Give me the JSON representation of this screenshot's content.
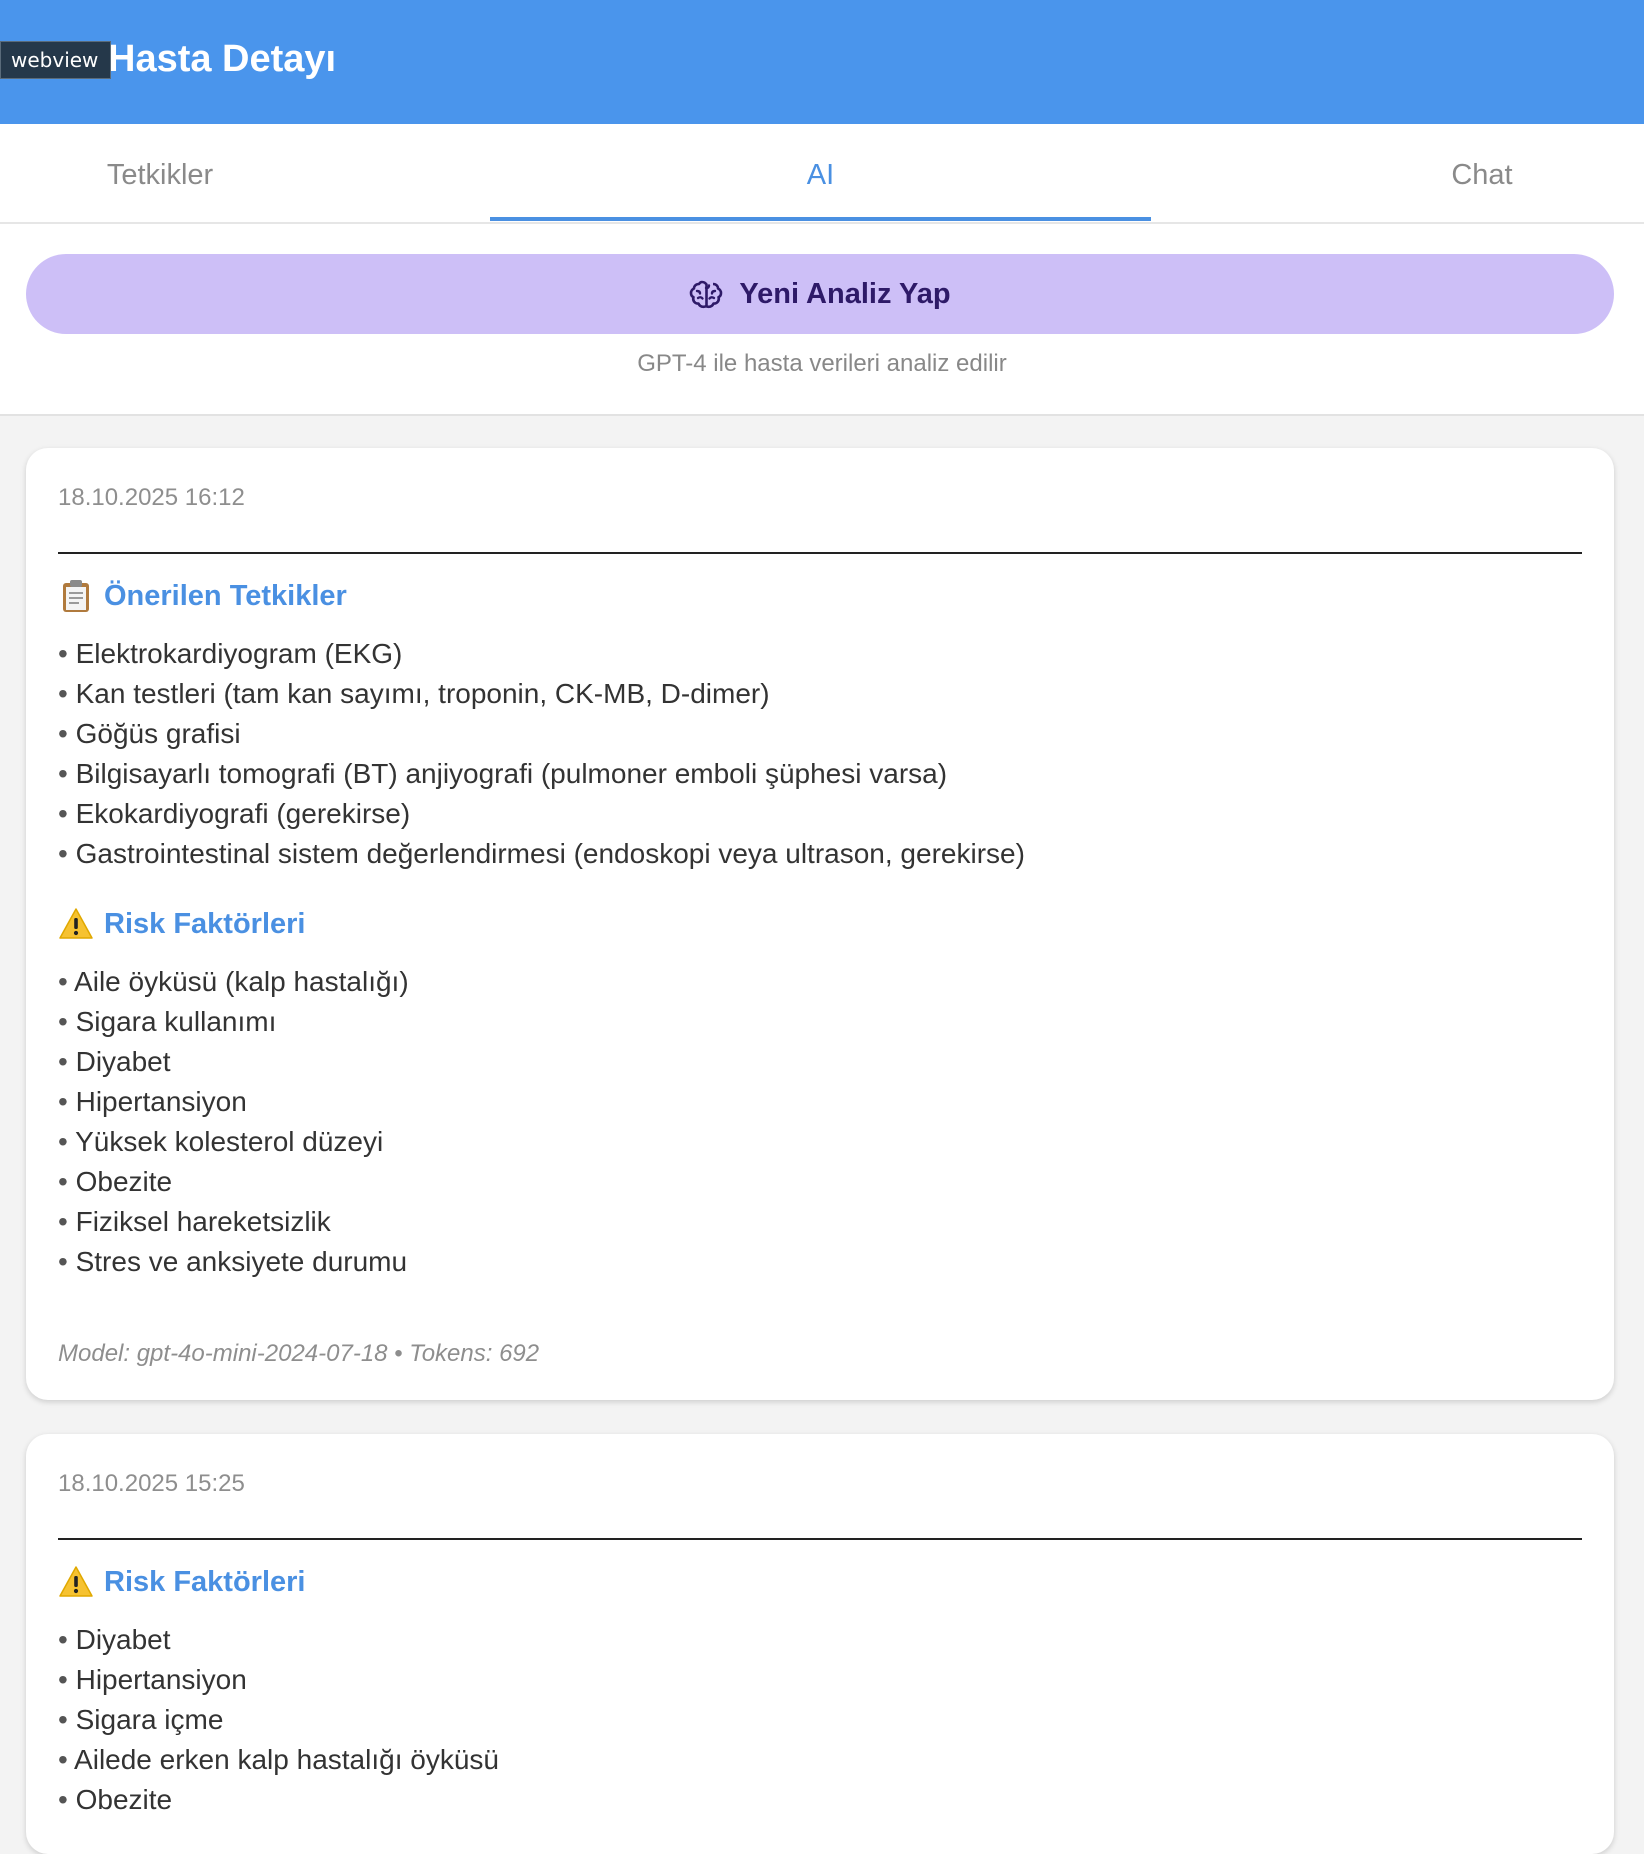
{
  "badge": "webview",
  "header": {
    "title": "Hasta Detayı"
  },
  "tabs": [
    {
      "label": "Tetkikler"
    },
    {
      "label": "AI"
    },
    {
      "label": "Chat"
    }
  ],
  "action": {
    "button_label": "Yeni Analiz Yap",
    "button_icon": "brain-icon",
    "note": "GPT-4 ile hasta verileri analiz edilir"
  },
  "colors": {
    "header": "#4a95ec",
    "accent": "#4a90e2",
    "button": "#cdbff7"
  },
  "analyses": [
    {
      "date": "18.10.2025 16:12",
      "sections": [
        {
          "icon": "clipboard-icon",
          "title": "Önerilen Tetkikler",
          "items": [
            "Elektrokardiyogram (EKG)",
            "Kan testleri (tam kan sayımı, troponin, CK-MB, D-dimer)",
            "Göğüs grafisi",
            "Bilgisayarlı tomografi (BT) anjiyografi (pulmoner emboli şüphesi varsa)",
            "Ekokardiyografi (gerekirse)",
            "Gastrointestinal sistem değerlendirmesi (endoskopi veya ultrason, gerekirse)"
          ]
        },
        {
          "icon": "warning-icon",
          "title": "Risk Faktörleri",
          "items": [
            "Aile öyküsü (kalp hastalığı)",
            "Sigara kullanımı",
            "Diyabet",
            "Hipertansiyon",
            "Yüksek kolesterol düzeyi",
            "Obezite",
            "Fiziksel hareketsizlik",
            "Stres ve anksiyete durumu"
          ]
        }
      ],
      "meta": "Model: gpt-4o-mini-2024-07-18 • Tokens: 692"
    },
    {
      "date": "18.10.2025 15:25",
      "sections": [
        {
          "icon": "warning-icon",
          "title": "Risk Faktörleri",
          "items": [
            "Diyabet",
            "Hipertansiyon",
            "Sigara içme",
            "Ailede erken kalp hastalığı öyküsü",
            "Obezite"
          ]
        }
      ]
    }
  ]
}
